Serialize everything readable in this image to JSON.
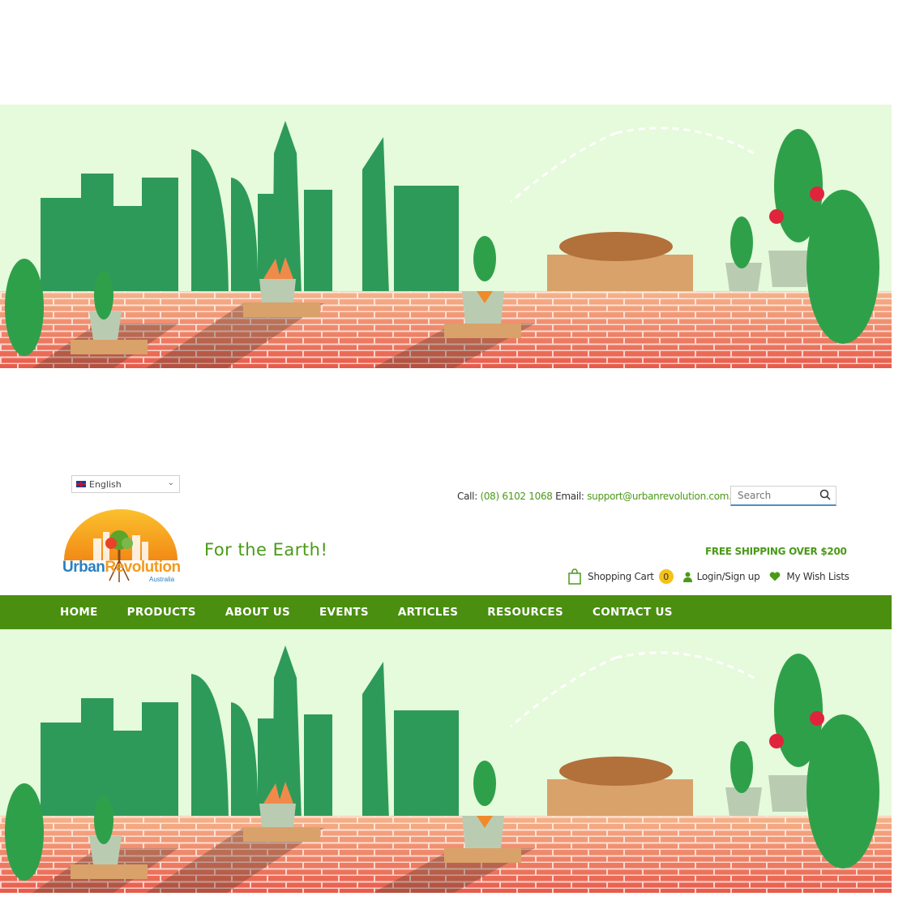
{
  "language": {
    "selected": "English"
  },
  "contact": {
    "call_label": "Call:",
    "phone": "(08) 6102 1068",
    "email_label": "Email:",
    "email": "support@urbanrevolution.com.au"
  },
  "search": {
    "placeholder": "Search"
  },
  "logo": {
    "name_part1": "Urban",
    "name_part2": "Revolution",
    "subtitle": "Australia"
  },
  "tagline": "For the Earth!",
  "promo": "FREE SHIPPING OVER $200",
  "utility": {
    "cart_label": "Shopping Cart",
    "cart_count": "0",
    "login_label": "Login/Sign up",
    "wishlist_label": "My Wish Lists"
  },
  "nav": {
    "items": [
      {
        "label": "HOME"
      },
      {
        "label": "PRODUCTS"
      },
      {
        "label": "ABOUT US"
      },
      {
        "label": "EVENTS"
      },
      {
        "label": "ARTICLES"
      },
      {
        "label": "RESOURCES"
      },
      {
        "label": "CONTACT US"
      }
    ]
  },
  "colors": {
    "brand_green": "#4a8f0f",
    "accent_green": "#4a9a18",
    "banner_bg": "#e6fadc",
    "skyline": "#2e9a5a",
    "brick": "#ee8a6a",
    "cart_badge": "#f5c218"
  },
  "icons": {
    "search": "search-icon",
    "cart": "shopping-bag-icon",
    "login": "user-icon",
    "wishlist": "heart-icon",
    "dropdown": "chevron-down-icon",
    "flag": "uk-flag-icon"
  }
}
